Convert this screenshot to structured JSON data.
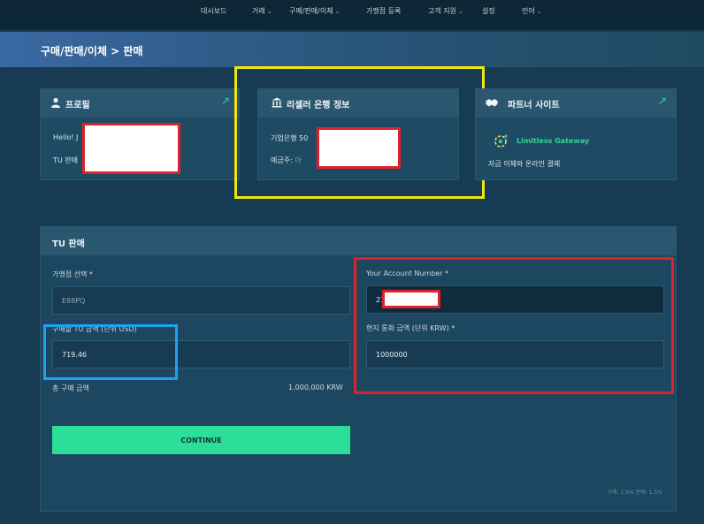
{
  "nav": {
    "items": [
      {
        "label": "대시보드",
        "chevron": false
      },
      {
        "label": "거래",
        "chevron": true
      },
      {
        "label": "구매/판매/이체",
        "chevron": true
      },
      {
        "label": "가맹점 등록",
        "chevron": false
      },
      {
        "label": "고객 지원",
        "chevron": true
      },
      {
        "label": "설정",
        "chevron": false
      },
      {
        "label": "언어",
        "chevron": true
      }
    ],
    "chevron_glyph": "⌄"
  },
  "breadcrumb": "구매/판매/이체 > 판매",
  "profile": {
    "title": "프로필",
    "hello": "Hello! J",
    "tu_sale": "TU 판매"
  },
  "bank": {
    "title": "리셀러 은행 정보",
    "bank_line": "기업은행 50",
    "holder_label": "예금주:",
    "holder_value": "아"
  },
  "partner": {
    "title": "파트너 사이트",
    "gateway_name": "Limitless Gateway",
    "description": "자금 이체와 온라인 결제"
  },
  "icons": {
    "external": "↗"
  },
  "form": {
    "title": "TU 판매",
    "merchant_label": "가맹점 선택 *",
    "merchant_value": "E88PQ",
    "tu_amount_label": "구매할 TU 금액 (단위 USD)",
    "tu_amount_value": "719.46",
    "account_label": "Your Account Number *",
    "account_value": "21",
    "local_amount_label": "현지 통화 금액 (단위 KRW) *",
    "local_amount_value": "1000000",
    "total_label": "총 구매 금액",
    "total_value": "1,000,000 KRW",
    "continue_label": "CONTINUE",
    "fee_note": "구매: 1.5% 판매: 1.5%"
  },
  "colors": {
    "accent_green": "#2bdf99",
    "highlight_yellow": "#f1e60c",
    "highlight_red": "#e0212b",
    "highlight_blue": "#1fa0f0"
  }
}
